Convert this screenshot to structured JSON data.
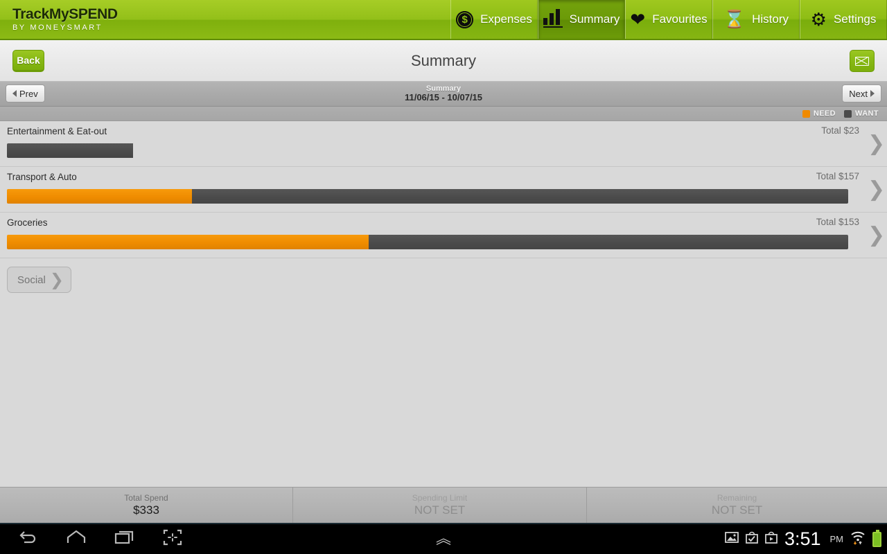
{
  "app": {
    "logo_main": "TrackMySPEND",
    "logo_sub": "BY MONEYSMART"
  },
  "nav": {
    "tabs": [
      {
        "label": "Expenses",
        "icon": "coin-dollar-icon",
        "active": false
      },
      {
        "label": "Summary",
        "icon": "bar-chart-icon",
        "active": true
      },
      {
        "label": "Favourites",
        "icon": "heart-icon",
        "active": false
      },
      {
        "label": "History",
        "icon": "hourglass-icon",
        "active": false
      },
      {
        "label": "Settings",
        "icon": "gear-icon",
        "active": false
      }
    ]
  },
  "titlebar": {
    "back_label": "Back",
    "title": "Summary",
    "mail_icon": "envelope-icon"
  },
  "datebar": {
    "prev_label": "Prev",
    "next_label": "Next",
    "period_label": "Summary",
    "date_range": "11/06/15 - 10/07/15"
  },
  "legend": {
    "need_label": "NEED",
    "want_label": "WANT",
    "need_color": "#f08a00",
    "want_color": "#4b4b4b"
  },
  "chart_data": {
    "type": "bar",
    "title": "Summary",
    "subtitle": "11/06/15 - 10/07/15",
    "series": [
      {
        "name": "NEED",
        "color": "#f08a00"
      },
      {
        "name": "WANT",
        "color": "#4b4b4b"
      }
    ],
    "categories": [
      "Entertainment & Eat-out",
      "Transport & Auto",
      "Groceries"
    ],
    "rows": [
      {
        "category": "Entertainment & Eat-out",
        "total_label": "Total $23",
        "total": 23,
        "need": 0,
        "want": 23,
        "need_pct": 0,
        "want_pct": 15
      },
      {
        "category": "Transport & Auto",
        "total_label": "Total $157",
        "total": 157,
        "need": 36,
        "want": 121,
        "need_pct": 22,
        "want_pct": 78
      },
      {
        "category": "Groceries",
        "total_label": "Total $153",
        "total": 153,
        "need": 75,
        "want": 78,
        "need_pct": 43,
        "want_pct": 57
      }
    ],
    "xlabel": "",
    "ylabel": "",
    "legend_position": "top-right",
    "grid": false
  },
  "social": {
    "label": "Social",
    "chevron": "chevron-right-icon"
  },
  "footer": {
    "cells": [
      {
        "label": "Total Spend",
        "value": "$333",
        "muted": false
      },
      {
        "label": "Spending Limit",
        "value": "NOT SET",
        "muted": true
      },
      {
        "label": "Remaining",
        "value": "NOT SET",
        "muted": true
      }
    ]
  },
  "system_bar": {
    "back_icon": "back-arrow-icon",
    "home_icon": "home-icon",
    "recents_icon": "recent-apps-icon",
    "screenshot_icon": "screenshot-icon",
    "expand_icon": "chevron-up-icon",
    "status_icons": [
      "image-icon",
      "download-complete-icon",
      "app-store-icon",
      "wifi-icon",
      "battery-icon"
    ],
    "time": "3:51",
    "meridiem": "PM"
  }
}
